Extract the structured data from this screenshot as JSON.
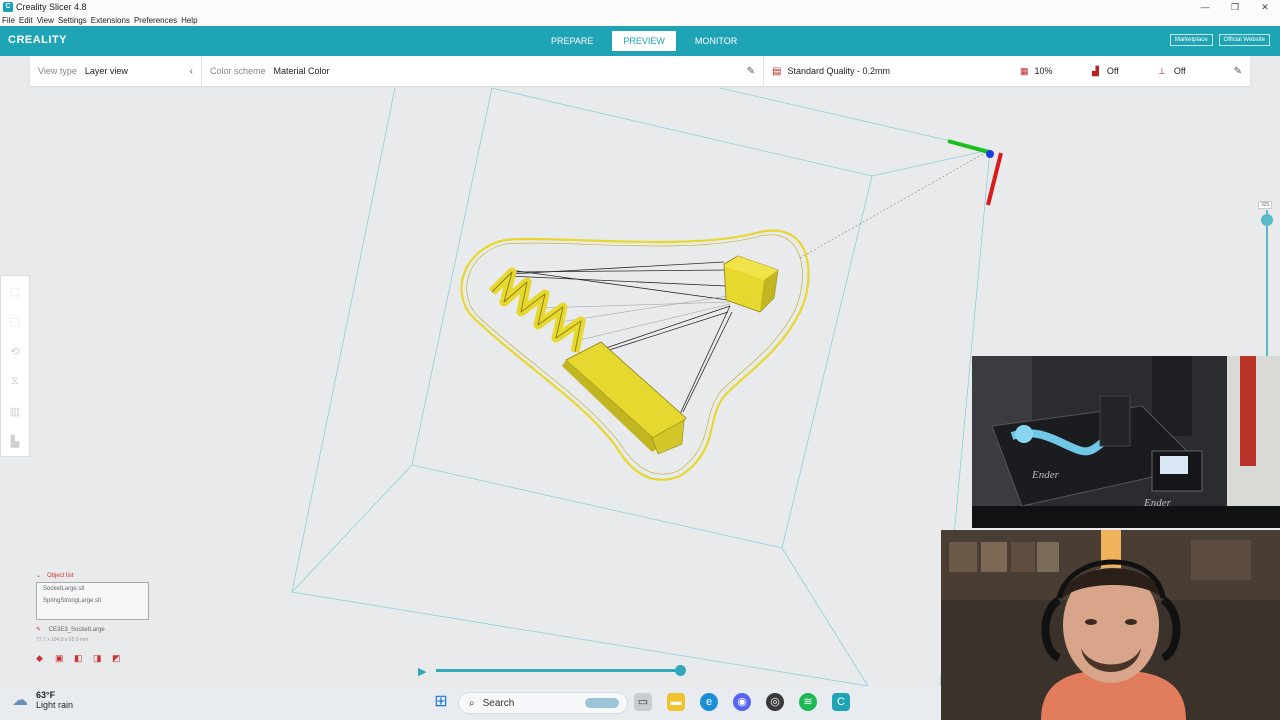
{
  "window": {
    "title": "Creality Slicer 4.8"
  },
  "menu": [
    "File",
    "Edit",
    "View",
    "Settings",
    "Extensions",
    "Preferences",
    "Help"
  ],
  "brand": "CREALITY",
  "tabs": [
    {
      "label": "PREPARE",
      "active": false
    },
    {
      "label": "PREVIEW",
      "active": true
    },
    {
      "label": "MONITOR",
      "active": false
    }
  ],
  "top_links": {
    "marketplace": "Marketplace",
    "website": "Official Website"
  },
  "settings": {
    "view_type_label": "View type",
    "view_type_value": "Layer view",
    "color_scheme_label": "Color scheme",
    "color_scheme_value": "Material Color",
    "profile": "Standard Quality - 0.2mm",
    "infill": "10%",
    "support": "Off",
    "adhesion": "Off"
  },
  "layer_slider": {
    "top_label": "325"
  },
  "object_list": {
    "header": "Object list",
    "items": [
      "SocketLarge.stl",
      "SpringStrongLarge.stl"
    ],
    "selected_name": "CE3E3_SocketLarge",
    "dimensions": "77.7 x 104.9 x 65.0 mm"
  },
  "playback": {
    "progress": 1.0
  },
  "taskbar": {
    "temperature": "63°F",
    "condition": "Light rain",
    "search_label": "Search"
  },
  "colors": {
    "accent": "#1fa4b6",
    "model_yellow": "#e6d82e",
    "axis_x": "#d81b1b",
    "axis_y": "#1bbf1b",
    "axis_z": "#1b3bd8"
  }
}
